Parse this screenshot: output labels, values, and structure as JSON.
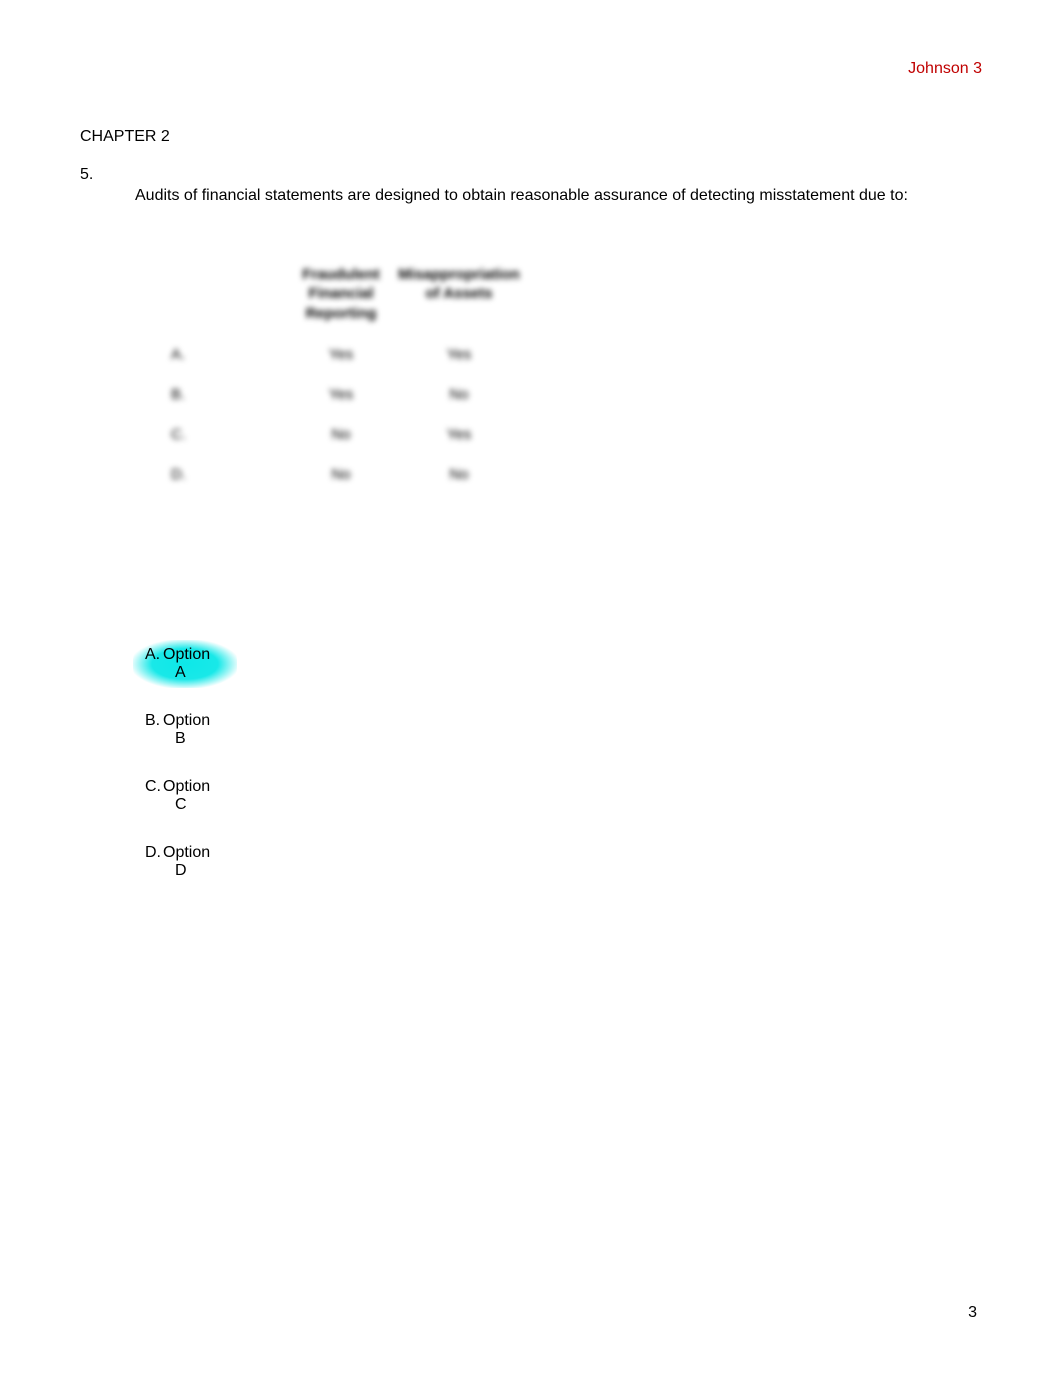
{
  "header": {
    "right": "Johnson 3"
  },
  "chapter": "CHAPTER 2",
  "question": {
    "number": "5.",
    "text": "Audits of financial statements are designed to obtain reasonable assurance of detecting misstatement due to:"
  },
  "table": {
    "headers": {
      "blank": "",
      "col2": "Fraudulent Financial Reporting",
      "col3": "Misappropriation of Assets"
    },
    "rows": [
      {
        "label": "A.",
        "c2": "Yes",
        "c3": "Yes"
      },
      {
        "label": "B.",
        "c2": "Yes",
        "c3": "No"
      },
      {
        "label": "C.",
        "c2": "No",
        "c3": "Yes"
      },
      {
        "label": "D.",
        "c2": "No",
        "c3": "No"
      }
    ]
  },
  "options": [
    {
      "letter": "A.",
      "line1": "Option",
      "line2": "A",
      "highlighted": true
    },
    {
      "letter": "B.",
      "line1": "Option",
      "line2": "B",
      "highlighted": false
    },
    {
      "letter": "C.",
      "line1": "Option",
      "line2": "C",
      "highlighted": false
    },
    {
      "letter": "D.",
      "line1": "Option",
      "line2": "D",
      "highlighted": false
    }
  ],
  "footer": {
    "pagenum": "3"
  }
}
